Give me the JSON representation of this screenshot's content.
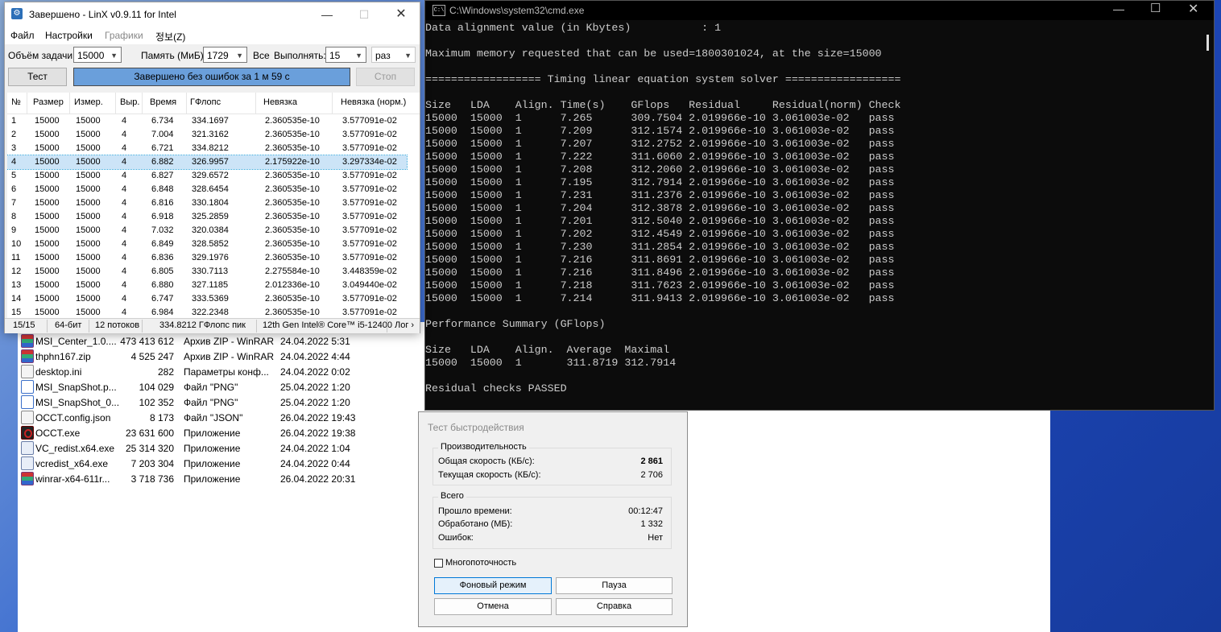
{
  "explorer": {
    "files": [
      {
        "icon": "rar",
        "name": "MSI_Center_1.0....",
        "size": "473 413 612",
        "type": "Архив ZIP - WinRAR",
        "date": "24.04.2022 5:31"
      },
      {
        "icon": "rar",
        "name": "thphn167.zip",
        "size": "4 525 247",
        "type": "Архив ZIP - WinRAR",
        "date": "24.04.2022 4:44"
      },
      {
        "icon": "doc",
        "name": "desktop.ini",
        "size": "282",
        "type": "Параметры конф...",
        "date": "24.04.2022 0:02"
      },
      {
        "icon": "png",
        "name": "MSI_SnapShot.p...",
        "size": "104 029",
        "type": "Файл \"PNG\"",
        "date": "25.04.2022 1:20"
      },
      {
        "icon": "png",
        "name": "MSI_SnapShot_0...",
        "size": "102 352",
        "type": "Файл \"PNG\"",
        "date": "25.04.2022 1:20"
      },
      {
        "icon": "doc",
        "name": "OCCT.config.json",
        "size": "8 173",
        "type": "Файл \"JSON\"",
        "date": "26.04.2022 19:43"
      },
      {
        "icon": "occt",
        "name": "OCCT.exe",
        "size": "23 631 600",
        "type": "Приложение",
        "date": "26.04.2022 19:38"
      },
      {
        "icon": "exe",
        "name": "VC_redist.x64.exe",
        "size": "25 314 320",
        "type": "Приложение",
        "date": "24.04.2022 1:04"
      },
      {
        "icon": "exe",
        "name": "vcredist_x64.exe",
        "size": "7 203 304",
        "type": "Приложение",
        "date": "24.04.2022 0:44"
      },
      {
        "icon": "rar",
        "name": "winrar-x64-611r...",
        "size": "3 718 736",
        "type": "Приложение",
        "date": "26.04.2022 20:31"
      }
    ]
  },
  "linx": {
    "title": "Завершено - LinX v0.9.11 for Intel",
    "menu": [
      "Файл",
      "Настройки",
      "Графики",
      "정보(Z)"
    ],
    "labels": {
      "size": "Объём задачи:",
      "memory": "Память (МиБ):",
      "all": "Все",
      "run": "Выполнять:"
    },
    "values": {
      "size": "15000",
      "memory": "1729",
      "runs": "15",
      "unit": "раз"
    },
    "buttons": {
      "test": "Тест",
      "stop": "Стоп"
    },
    "progress_text": "Завершено без ошибок за 1 м 59 с",
    "progress": 1.0,
    "columns": [
      "№",
      "Размер",
      "Измер.",
      "Выр.",
      "Время",
      "ГФлопс",
      "Невязка",
      "Невязка (норм.)"
    ],
    "rows": [
      [
        "1",
        "15000",
        "15000",
        "4",
        "6.734",
        "334.1697",
        "2.360535e-10",
        "3.577091e-02"
      ],
      [
        "2",
        "15000",
        "15000",
        "4",
        "7.004",
        "321.3162",
        "2.360535e-10",
        "3.577091e-02"
      ],
      [
        "3",
        "15000",
        "15000",
        "4",
        "6.721",
        "334.8212",
        "2.360535e-10",
        "3.577091e-02"
      ],
      [
        "4",
        "15000",
        "15000",
        "4",
        "6.882",
        "326.9957",
        "2.175922e-10",
        "3.297334e-02"
      ],
      [
        "5",
        "15000",
        "15000",
        "4",
        "6.827",
        "329.6572",
        "2.360535e-10",
        "3.577091e-02"
      ],
      [
        "6",
        "15000",
        "15000",
        "4",
        "6.848",
        "328.6454",
        "2.360535e-10",
        "3.577091e-02"
      ],
      [
        "7",
        "15000",
        "15000",
        "4",
        "6.816",
        "330.1804",
        "2.360535e-10",
        "3.577091e-02"
      ],
      [
        "8",
        "15000",
        "15000",
        "4",
        "6.918",
        "325.2859",
        "2.360535e-10",
        "3.577091e-02"
      ],
      [
        "9",
        "15000",
        "15000",
        "4",
        "7.032",
        "320.0384",
        "2.360535e-10",
        "3.577091e-02"
      ],
      [
        "10",
        "15000",
        "15000",
        "4",
        "6.849",
        "328.5852",
        "2.360535e-10",
        "3.577091e-02"
      ],
      [
        "11",
        "15000",
        "15000",
        "4",
        "6.836",
        "329.1976",
        "2.360535e-10",
        "3.577091e-02"
      ],
      [
        "12",
        "15000",
        "15000",
        "4",
        "6.805",
        "330.7113",
        "2.275584e-10",
        "3.448359e-02"
      ],
      [
        "13",
        "15000",
        "15000",
        "4",
        "6.880",
        "327.1185",
        "2.012336e-10",
        "3.049440e-02"
      ],
      [
        "14",
        "15000",
        "15000",
        "4",
        "6.747",
        "333.5369",
        "2.360535e-10",
        "3.577091e-02"
      ],
      [
        "15",
        "15000",
        "15000",
        "4",
        "6.984",
        "322.2348",
        "2.360535e-10",
        "3.577091e-02"
      ]
    ],
    "status": [
      "15/15",
      "64-бит",
      "12 потоков",
      "334.8212 ГФлопс пик",
      "12th Gen Intel® Core™ i5-12400",
      "Лог ›"
    ]
  },
  "cmd": {
    "title": "C:\\Windows\\system32\\cmd.exe",
    "lines": [
      "Data alignment value (in Kbytes)           : 1",
      "",
      "Maximum memory requested that can be used=1800301024, at the size=15000",
      "",
      "================== Timing linear equation system solver ==================",
      "",
      "Size   LDA    Align. Time(s)    GFlops   Residual     Residual(norm) Check",
      "15000  15000  1      7.265      309.7504 2.019966e-10 3.061003e-02   pass",
      "15000  15000  1      7.209      312.1574 2.019966e-10 3.061003e-02   pass",
      "15000  15000  1      7.207      312.2752 2.019966e-10 3.061003e-02   pass",
      "15000  15000  1      7.222      311.6060 2.019966e-10 3.061003e-02   pass",
      "15000  15000  1      7.208      312.2060 2.019966e-10 3.061003e-02   pass",
      "15000  15000  1      7.195      312.7914 2.019966e-10 3.061003e-02   pass",
      "15000  15000  1      7.231      311.2376 2.019966e-10 3.061003e-02   pass",
      "15000  15000  1      7.204      312.3878 2.019966e-10 3.061003e-02   pass",
      "15000  15000  1      7.201      312.5040 2.019966e-10 3.061003e-02   pass",
      "15000  15000  1      7.202      312.4549 2.019966e-10 3.061003e-02   pass",
      "15000  15000  1      7.230      311.2854 2.019966e-10 3.061003e-02   pass",
      "15000  15000  1      7.216      311.8691 2.019966e-10 3.061003e-02   pass",
      "15000  15000  1      7.216      311.8496 2.019966e-10 3.061003e-02   pass",
      "15000  15000  1      7.218      311.7623 2.019966e-10 3.061003e-02   pass",
      "15000  15000  1      7.214      311.9413 2.019966e-10 3.061003e-02   pass",
      "",
      "Performance Summary (GFlops)",
      "",
      "Size   LDA    Align.  Average  Maximal",
      "15000  15000  1       311.8719 312.7914",
      "",
      "Residual checks PASSED"
    ]
  },
  "perf": {
    "title": "Тест быстродействия",
    "group1": "Производительность",
    "total_speed_label": "Общая скорость (КБ/с):",
    "total_speed": "2 861",
    "current_speed_label": "Текущая скорость (КБ/с):",
    "current_speed": "2 706",
    "group2": "Всего",
    "elapsed_label": "Прошло времени:",
    "elapsed": "00:12:47",
    "processed_label": "Обработано (МБ):",
    "processed": "1 332",
    "errors_label": "Ошибок:",
    "errors": "Нет",
    "multithread_label": "Многопоточность",
    "buttons": {
      "background": "Фоновый режим",
      "pause": "Пауза",
      "cancel": "Отмена",
      "help": "Справка"
    }
  },
  "colors": {
    "progress": "#6a9fdb",
    "selection": "#cce4f7",
    "console_text": "#cccccc",
    "console_bg": "#0c0c0c"
  }
}
